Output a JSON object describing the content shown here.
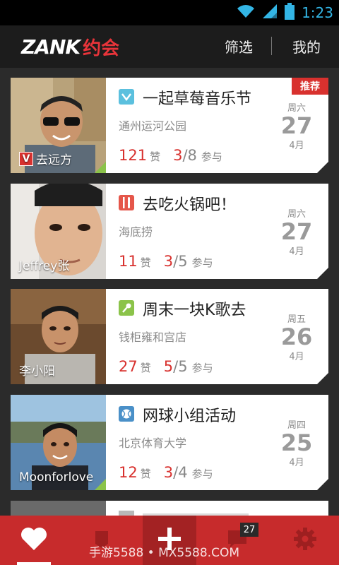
{
  "status": {
    "time": "1:23"
  },
  "header": {
    "logo_latin": "ZANK",
    "logo_cn": "约会",
    "filter": "筛选",
    "mine": "我的"
  },
  "events": [
    {
      "name": "去远方",
      "verified": "V",
      "title": "一起草莓音乐节",
      "place": "通州运河公园",
      "likes": "121",
      "likes_label": "赞",
      "joined": "3",
      "capacity": "/8",
      "join_label": "参与",
      "weekday": "周六",
      "day": "27",
      "month": "4月",
      "badge": "推荐",
      "icon": "music-icon",
      "icon_color": "#5bc0de"
    },
    {
      "name": "Jeffrey张",
      "title": "去吃火锅吧！",
      "place": "海底捞",
      "likes": "11",
      "likes_label": "赞",
      "joined": "3",
      "capacity": "/5",
      "join_label": "参与",
      "weekday": "周六",
      "day": "27",
      "month": "4月",
      "icon": "food-icon",
      "icon_color": "#e5564a"
    },
    {
      "name": "李小阳",
      "title": "周末一块K歌去",
      "place": "钱柜雍和宫店",
      "likes": "27",
      "likes_label": "赞",
      "joined": "5",
      "capacity": "/5",
      "join_label": "参与",
      "weekday": "周五",
      "day": "26",
      "month": "4月",
      "icon": "microphone-icon",
      "icon_color": "#8bc34a"
    },
    {
      "name": "Moonforlove",
      "title": "网球小组活动",
      "place": "北京体育大学",
      "likes": "12",
      "likes_label": "赞",
      "joined": "3",
      "capacity": "/4",
      "join_label": "参与",
      "weekday": "周四",
      "day": "25",
      "month": "4月",
      "icon": "tennis-icon",
      "icon_color": "#4a90c8"
    }
  ],
  "tabs": {
    "messages_badge": "27"
  },
  "watermark": "手游5588 • MX5588.COM",
  "colors": {
    "accent": "#d8312e",
    "tabbar": "#c72b2c",
    "background": "#2b2b2b"
  }
}
